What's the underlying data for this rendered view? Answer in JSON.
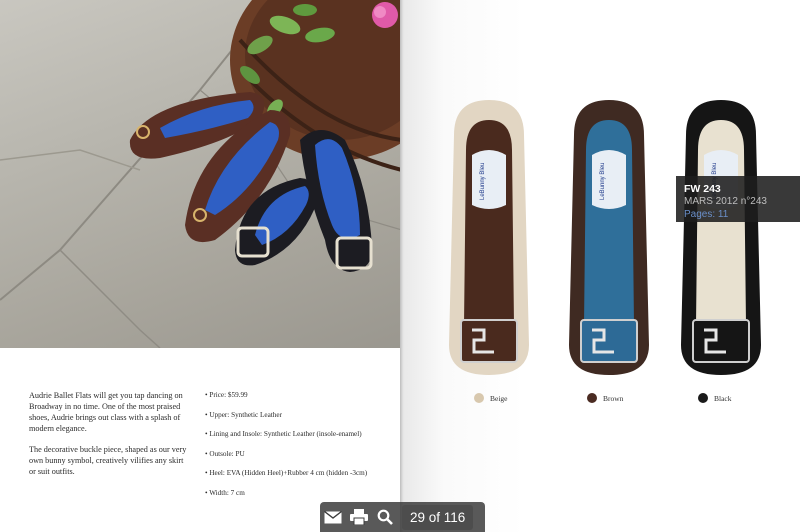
{
  "description": {
    "paragraph1": "Audrie Ballet Flats will get you tap dancing on Broadway in no time. One of the most praised shoes, Audrie brings out class with a splash of modern elegance.",
    "paragraph2": "The decorative buckle piece, shaped as our very own bunny symbol, creatively vilifies any skirt or suit outfits."
  },
  "specs": [
    "Price: $59.99",
    "Upper: Synthetic Leather",
    "Lining and Insole: Synthetic Leather (insole-enamel)",
    "Outsole: PU",
    "Heel: EVA (Hidden Heel)+Rubber  4 cm (hidden -3cm)",
    "Width: 7 cm"
  ],
  "colors": [
    {
      "label": "Beige",
      "hex": "#d8c8ae"
    },
    {
      "label": "Brown",
      "hex": "#4a2b22"
    },
    {
      "label": "Black",
      "hex": "#1a1a1a"
    }
  ],
  "insole_brand": "LeBunny Bleu",
  "tooltip": {
    "title": "FW 243",
    "issue": "MARS 2012 n°243",
    "pages": "Pages: 11"
  },
  "toolbar": {
    "page_indicator": "29 of 116",
    "icons": [
      "mail-icon",
      "print-icon",
      "search-icon"
    ]
  }
}
